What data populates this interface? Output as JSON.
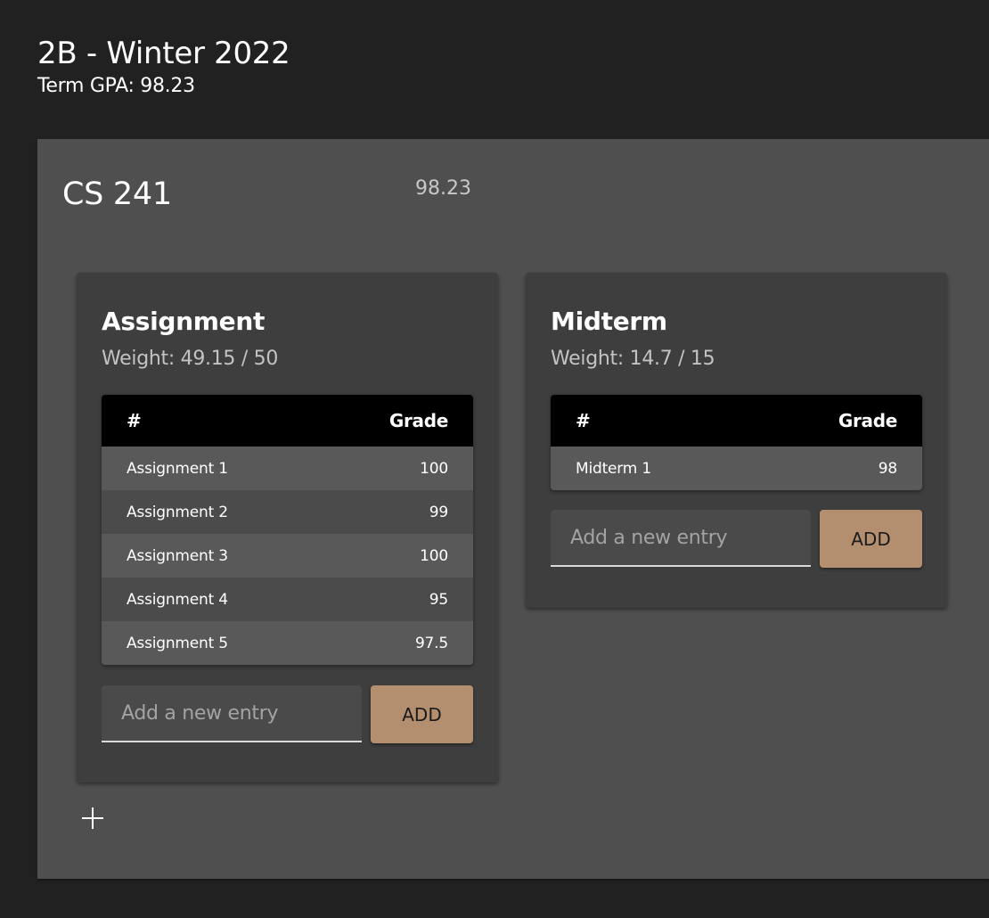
{
  "term": {
    "title": "2B - Winter 2022",
    "gpa_text": "Term GPA: 98.23"
  },
  "course": {
    "name": "CS 241",
    "grade": "98.23",
    "add_category_icon": "plus-icon",
    "categories": [
      {
        "title": "Assignment",
        "weight_text": "Weight: 49.15 / 50",
        "header": {
          "col1": "#",
          "col2": "Grade"
        },
        "rows": [
          {
            "name": "Assignment 1",
            "grade": "100"
          },
          {
            "name": "Assignment 2",
            "grade": "99"
          },
          {
            "name": "Assignment 3",
            "grade": "100"
          },
          {
            "name": "Assignment 4",
            "grade": "95"
          },
          {
            "name": "Assignment 5",
            "grade": "97.5"
          }
        ],
        "input_placeholder": "Add a new entry",
        "add_label": "ADD"
      },
      {
        "title": "Midterm",
        "weight_text": "Weight: 14.7 / 15",
        "header": {
          "col1": "#",
          "col2": "Grade"
        },
        "rows": [
          {
            "name": "Midterm 1",
            "grade": "98"
          }
        ],
        "input_placeholder": "Add a new entry",
        "add_label": "ADD"
      }
    ]
  },
  "colors": {
    "background": "#212121",
    "panel": "#4f4f4f",
    "card": "#3e3e3e",
    "accent_button": "#b48f6f",
    "table_header": "#000000"
  }
}
